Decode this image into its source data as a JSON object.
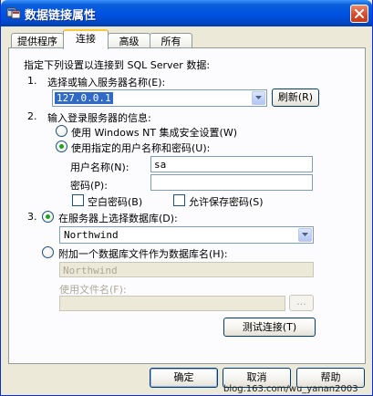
{
  "window": {
    "title": "数据链接属性",
    "close_icon": "close-icon",
    "app_icon": "data-link-icon"
  },
  "tabs": [
    {
      "label": "提供程序",
      "active": false
    },
    {
      "label": "连接",
      "active": true
    },
    {
      "label": "高级",
      "active": false
    },
    {
      "label": "所有",
      "active": false
    }
  ],
  "connection": {
    "intro": "指定下列设置以连接到 SQL Server 数据:",
    "step1": {
      "num": "1.",
      "label": "选择或输入服务器名称(E):",
      "server_value": "127.0.0.1",
      "refresh_label": "刷新(R)"
    },
    "step2": {
      "num": "2.",
      "label": "输入登录服务器的信息:",
      "radio_nt_label": "使用 Windows NT 集成安全设置(W)",
      "radio_user_label": "使用指定的用户名称和密码(U):",
      "username_label": "用户名称(N):",
      "username_value": "sa",
      "password_label": "密码(P):",
      "password_value": "",
      "blank_password_label": "空白密码(B)",
      "allow_save_label": "允许保存密码(S)"
    },
    "step3": {
      "num": "3.",
      "radio_db_label": "在服务器上选择数据库(D):",
      "database_value": "Northwind",
      "radio_attach_label": "附加一个数据库文件作为数据库名(H):",
      "attach_name_value": "Northwind",
      "file_name_label": "使用文件名(F):",
      "file_name_value": "",
      "browse_label": "..."
    },
    "test_button_label": "测试连接(T)"
  },
  "footer": {
    "ok_label": "确定",
    "cancel_label": "取消",
    "help_label": "帮助"
  },
  "watermark": "blog.163.com/wu_yanan2003"
}
